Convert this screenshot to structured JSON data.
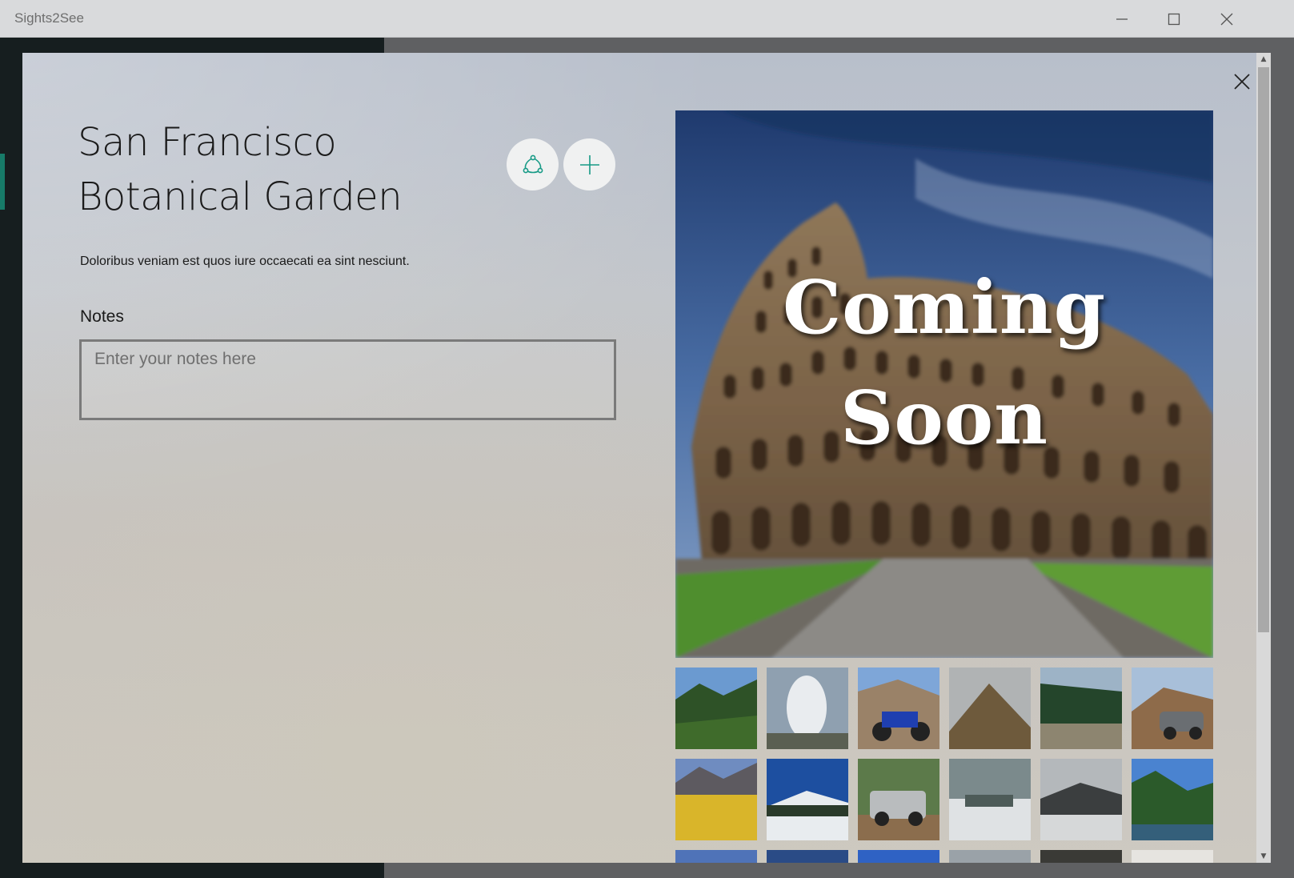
{
  "window": {
    "title": "Sights2See",
    "minimize_icon": "minimize-icon",
    "maximize_icon": "maximize-icon",
    "close_icon": "close-icon"
  },
  "dialog": {
    "title": "San Francisco Botanical Garden",
    "description": "Doloribus veniam est quos iure occaecati ea sint nesciunt.",
    "notes_label": "Notes",
    "notes_placeholder": "Enter your notes here",
    "notes_value": "",
    "share_icon": "share-icon",
    "add_icon": "plus-icon",
    "close_icon": "close-icon",
    "hero": {
      "line1": "Coming",
      "line2": "Soon"
    },
    "thumbnails": [
      {
        "name": "forest-valley"
      },
      {
        "name": "geyser"
      },
      {
        "name": "dirt-bike-mountain"
      },
      {
        "name": "mountain-ridge"
      },
      {
        "name": "forest-trail-bikers"
      },
      {
        "name": "jeep-mountain"
      },
      {
        "name": "aspen-trees"
      },
      {
        "name": "snowy-valley"
      },
      {
        "name": "pickup-truck-forest"
      },
      {
        "name": "snowy-forest-stream"
      },
      {
        "name": "snowy-peak-clouds"
      },
      {
        "name": "mountain-lake"
      },
      {
        "name": "row3-1"
      },
      {
        "name": "row3-2"
      },
      {
        "name": "row3-3"
      },
      {
        "name": "row3-4"
      },
      {
        "name": "row3-5"
      },
      {
        "name": "row3-6"
      }
    ]
  },
  "colors": {
    "accent": "#179a86",
    "titlebar": "#d9dadc"
  }
}
